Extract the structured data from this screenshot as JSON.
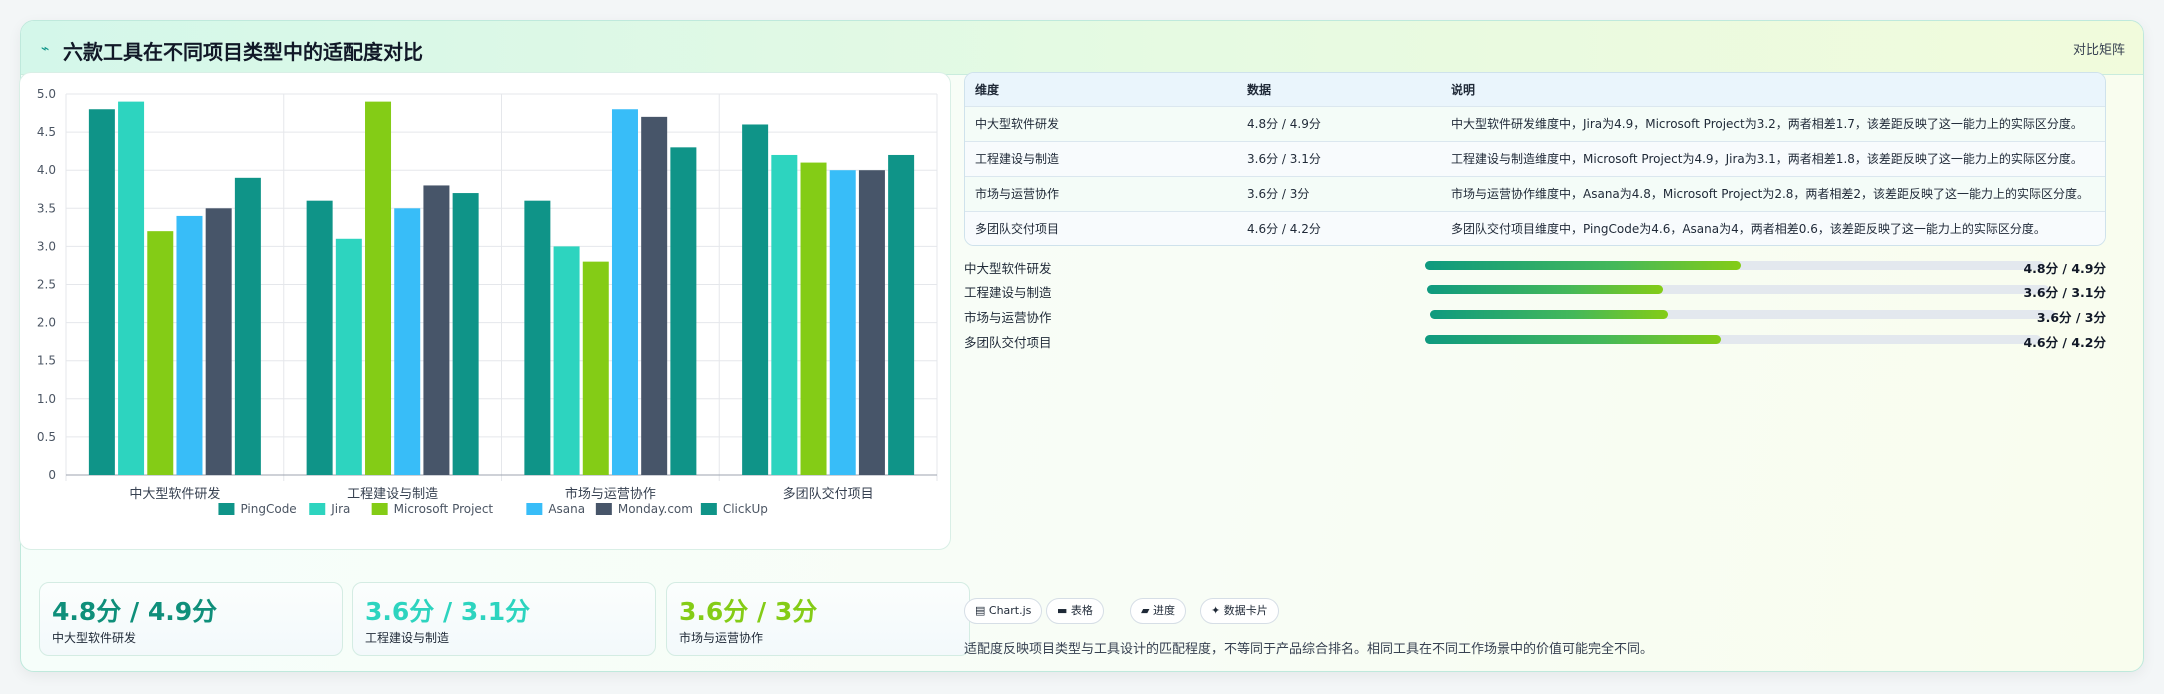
{
  "header": {
    "icon": "chart-line-icon",
    "icon_glyph": "⌁",
    "title": "六款工具在不同项目类型中的适配度对比",
    "tag": "对比矩阵"
  },
  "chart_data": {
    "type": "bar",
    "categories": [
      "中大型软件研发",
      "工程建设与制造",
      "市场与运营协作",
      "多团队交付项目"
    ],
    "series": [
      {
        "name": "PingCode",
        "color": "#0f9488",
        "values": [
          4.8,
          3.6,
          3.6,
          4.6
        ]
      },
      {
        "name": "Jira",
        "color": "#2dd4bf",
        "values": [
          4.9,
          3.1,
          3.0,
          4.2
        ]
      },
      {
        "name": "Microsoft Project",
        "color": "#84cc16",
        "values": [
          3.2,
          4.9,
          2.8,
          4.1
        ]
      },
      {
        "name": "Asana",
        "color": "#38bdf8",
        "values": [
          3.4,
          3.5,
          4.8,
          4.0
        ]
      },
      {
        "name": "Monday.com",
        "color": "#475569",
        "values": [
          3.5,
          3.8,
          4.7,
          4.0
        ]
      },
      {
        "name": "ClickUp",
        "color": "#0f9488",
        "values": [
          3.9,
          3.7,
          4.3,
          4.2
        ]
      }
    ],
    "ylim": [
      0,
      5
    ],
    "yticks": [
      "0",
      "0.5",
      "1.0",
      "1.5",
      "2.0",
      "2.5",
      "3.0",
      "3.5",
      "4.0",
      "4.5",
      "5.0"
    ],
    "grid": true,
    "legend": "bottom"
  },
  "table": {
    "headers": [
      "维度",
      "数据",
      "说明"
    ],
    "rows": [
      [
        "中大型软件研发",
        "4.8分 / 4.9分",
        "中大型软件研发维度中，Jira为4.9，Microsoft Project为3.2，两者相差1.7，该差距反映了这一能力上的实际区分度。"
      ],
      [
        "工程建设与制造",
        "3.6分 / 3.1分",
        "工程建设与制造维度中，Microsoft Project为4.9，Jira为3.1，两者相差1.8，该差距反映了这一能力上的实际区分度。"
      ],
      [
        "市场与运营协作",
        "3.6分 / 3分",
        "市场与运营协作维度中，Asana为4.8，Microsoft Project为2.8，两者相差2，该差距反映了这一能力上的实际区分度。"
      ],
      [
        "多团队交付项目",
        "4.6分 / 4.2分",
        "多团队交付项目维度中，PingCode为4.6，Asana为4，两者相差0.6，该差距反映了这一能力上的实际区分度。"
      ]
    ]
  },
  "progress": [
    {
      "label": "中大型软件研发",
      "value": "4.8分 / 4.9分",
      "fraction": 0.51
    },
    {
      "label": "工程建设与制造",
      "value": "3.6分 / 3.1分",
      "fraction": 0.38
    },
    {
      "label": "市场与运营协作",
      "value": "3.6分 / 3分",
      "fraction": 0.38
    },
    {
      "label": "多团队交付项目",
      "value": "4.6分 / 4.2分",
      "fraction": 0.48
    }
  ],
  "stats": [
    {
      "value": "4.8分 / 4.9分",
      "label": "中大型软件研发",
      "color": "#0f8f7a"
    },
    {
      "value": "3.6分 / 3.1分",
      "label": "工程建设与制造",
      "color": "#2dd4bf"
    },
    {
      "value": "3.6分 / 3分",
      "label": "市场与运营协作",
      "color": "#84cc16"
    }
  ],
  "chips": [
    {
      "icon": "chart-icon",
      "label": "▤ Chart.js"
    },
    {
      "icon": "table-icon",
      "label": "▬ 表格"
    },
    {
      "icon": "progress-icon",
      "label": "▰ 进度"
    },
    {
      "icon": "sparkle-icon",
      "label": "✦ 数据卡片"
    }
  ],
  "note": "适配度反映项目类型与工具设计的匹配程度，不等同于产品综合排名。相同工具在不同工作场景中的价值可能完全不同。"
}
